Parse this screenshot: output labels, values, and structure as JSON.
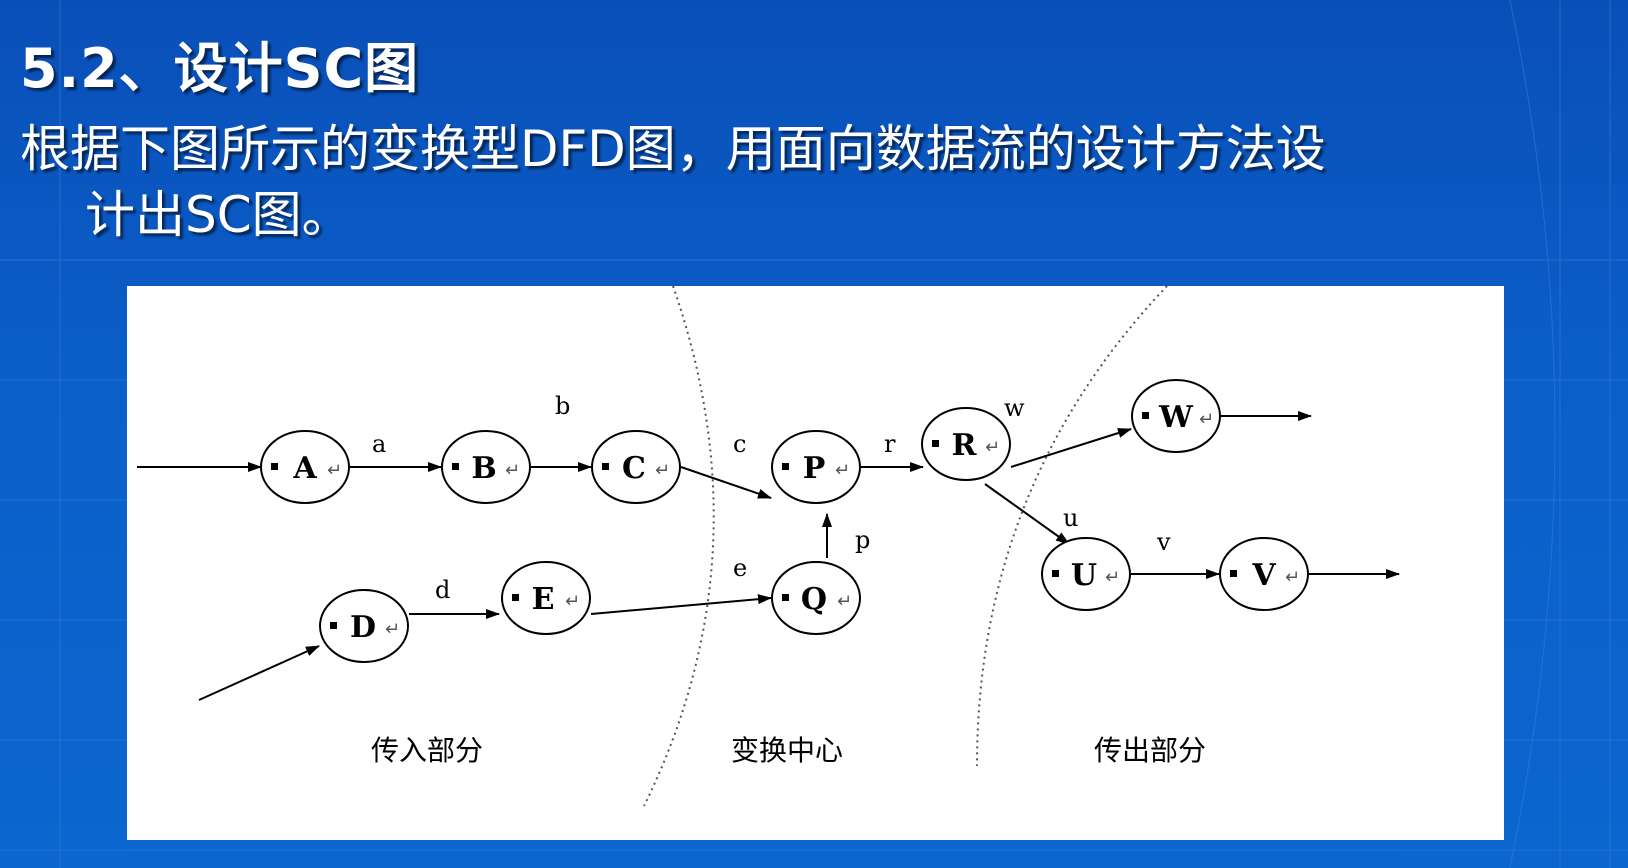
{
  "slide": {
    "title": "5.2、设计SC图",
    "body_line1": "根据下图所示的变换型DFD图，用面向数据流的设计方法设",
    "body_line2": "计出SC图。"
  },
  "diagram": {
    "nodes": {
      "A": "A",
      "B": "B",
      "C": "C",
      "D": "D",
      "E": "E",
      "P": "P",
      "Q": "Q",
      "R": "R",
      "U": "U",
      "V": "V",
      "W": "W"
    },
    "flows": {
      "a": "a",
      "b": "b",
      "c": "c",
      "d": "d",
      "e": "e",
      "p": "p",
      "r": "r",
      "u": "u",
      "v": "v",
      "w": "w"
    },
    "regions": {
      "input": "传入部分",
      "transform": "变换中心",
      "output": "传出部分"
    },
    "colors": {
      "background": "#0b5fc9",
      "panel": "#ffffff",
      "ink": "#000000"
    }
  }
}
